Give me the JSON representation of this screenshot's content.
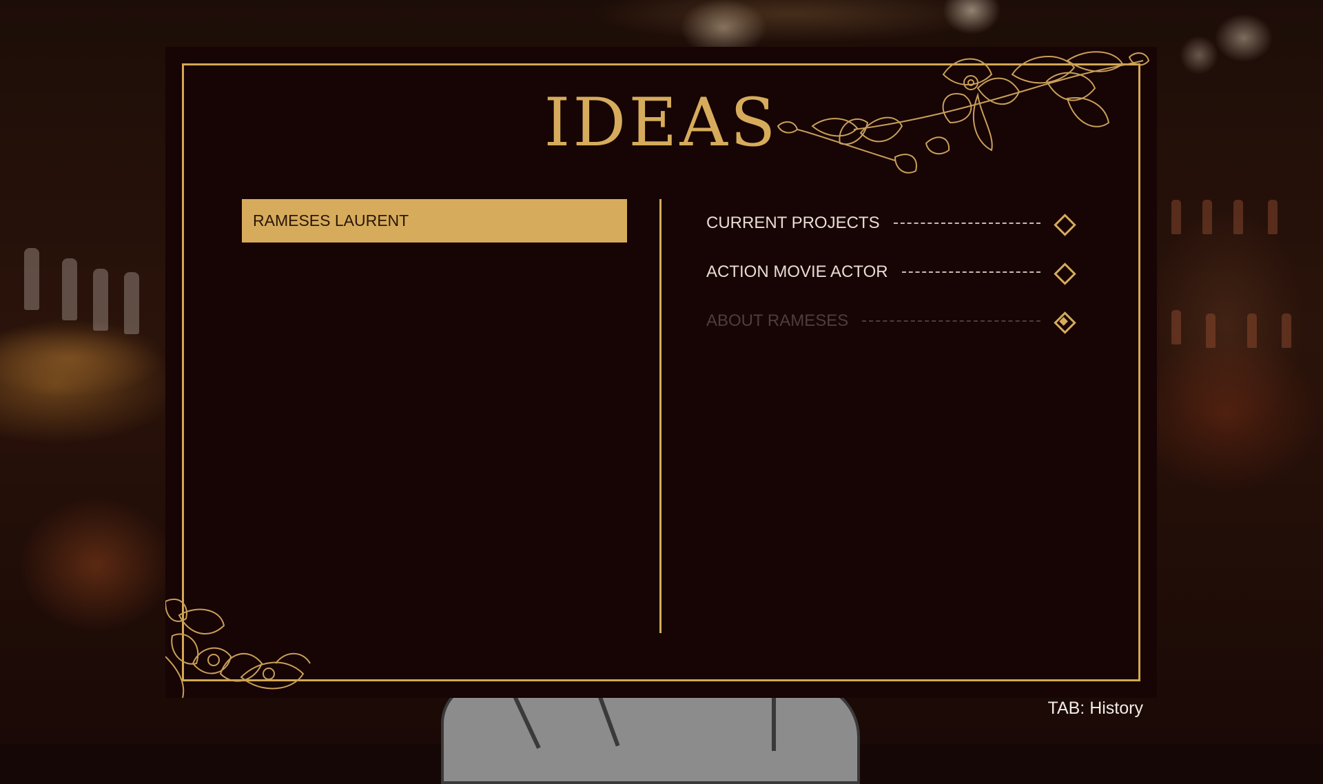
{
  "panel": {
    "title": "IDEAS",
    "selected_item": "RAMESES LAURENT"
  },
  "ideas": [
    {
      "label": "CURRENT PROJECTS",
      "state": "new",
      "dimmed": false
    },
    {
      "label": "ACTION MOVIE ACTOR",
      "state": "new",
      "dimmed": false
    },
    {
      "label": "ABOUT RAMESES",
      "state": "read",
      "dimmed": true
    }
  ],
  "hint": {
    "text": "TAB: History"
  },
  "colors": {
    "accent_gold": "#d6ac5c",
    "panel_bg": "#170404",
    "text_light": "#e8ddd3",
    "text_dim": "#4c3e3b"
  },
  "icons": {
    "idea_marker_new": "diamond-outline-icon",
    "idea_marker_read": "diamond-filled-icon",
    "decoration": "orchid-flowers-icon"
  }
}
